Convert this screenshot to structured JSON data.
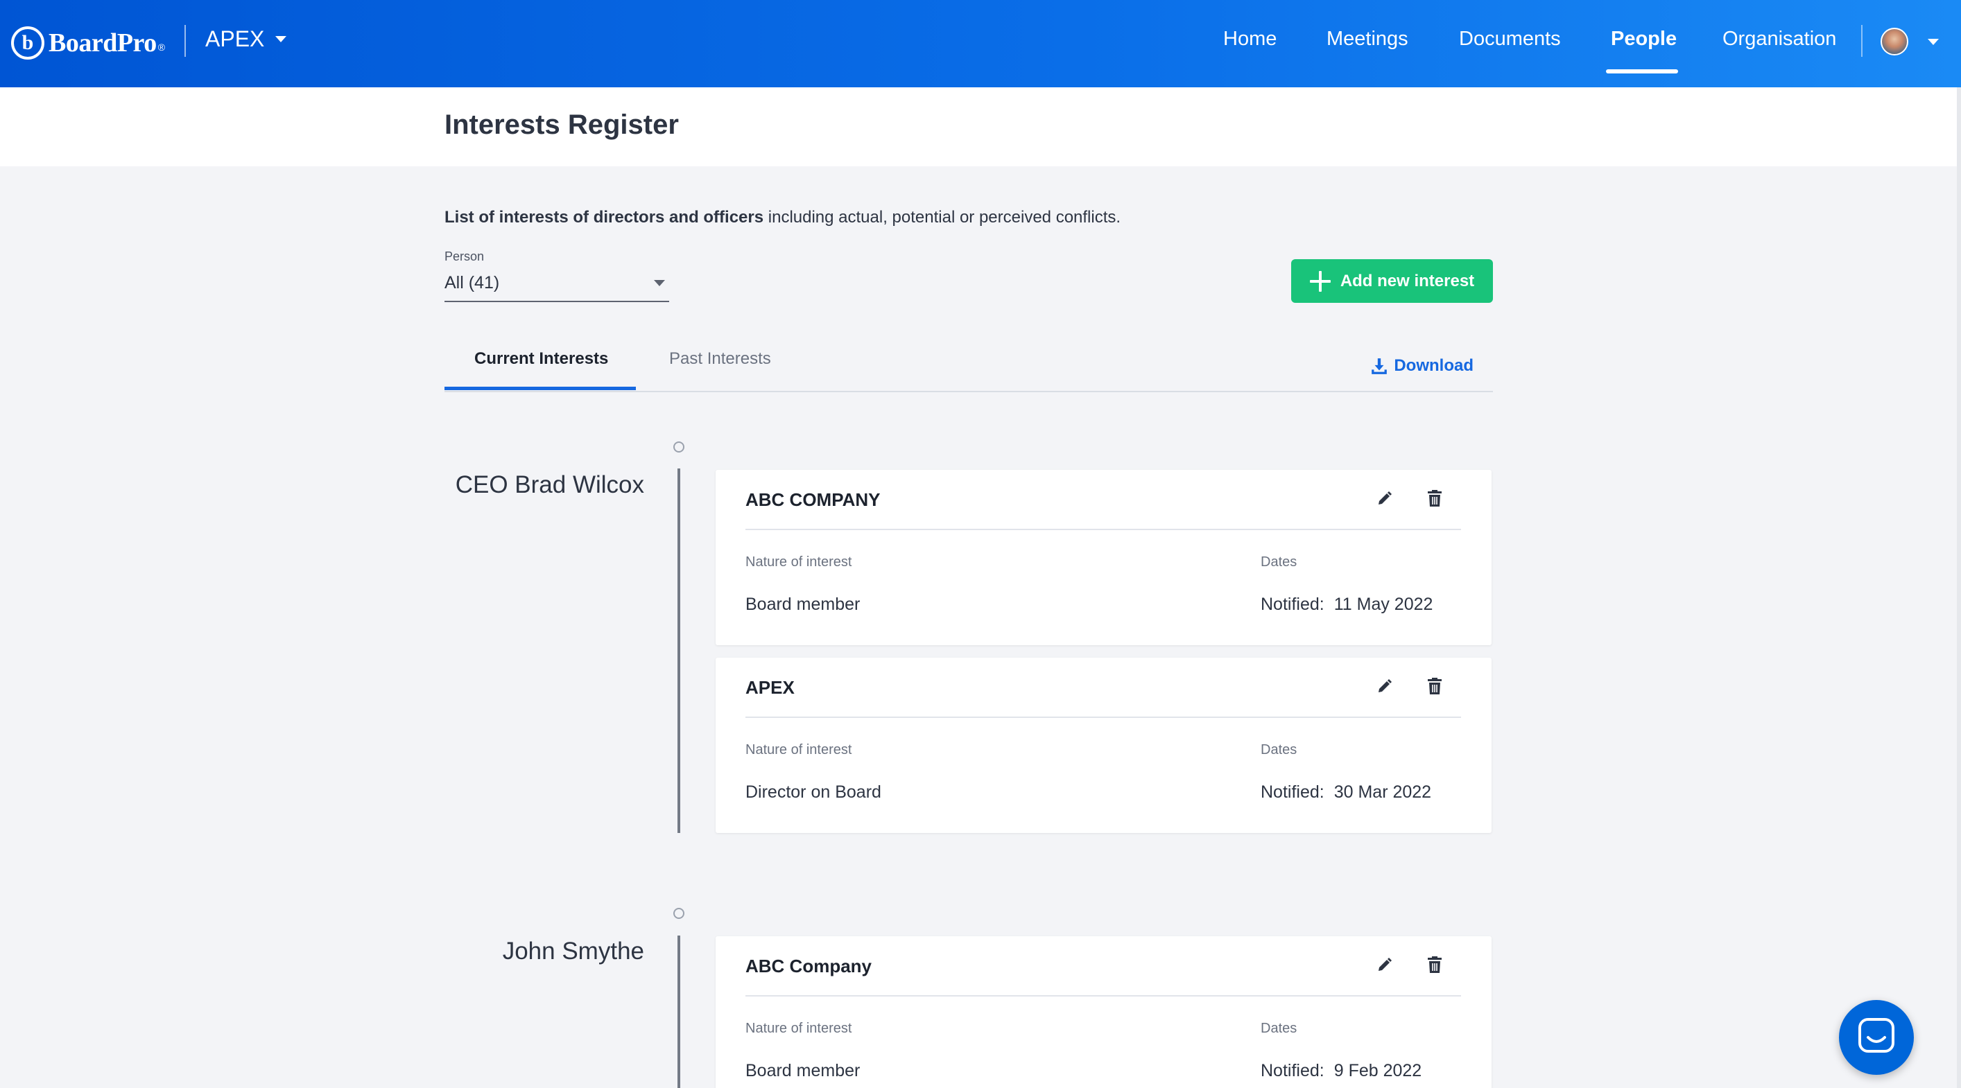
{
  "app": {
    "logo_mark": "b",
    "logo_text": "BoardPro",
    "logo_tm": "®",
    "org_name": "APEX"
  },
  "nav": {
    "items": [
      {
        "label": "Home"
      },
      {
        "label": "Meetings"
      },
      {
        "label": "Documents"
      },
      {
        "label": "People",
        "active": true
      },
      {
        "label": "Organisation"
      }
    ]
  },
  "page": {
    "title": "Interests Register",
    "subtitle_bold": "List of interests of directors and officers",
    "subtitle_rest": " including actual, potential or perceived conflicts."
  },
  "filter": {
    "person_label": "Person",
    "person_value": "All (41)"
  },
  "actions": {
    "add_label": "Add new interest",
    "download_label": "Download"
  },
  "tabs": {
    "current": "Current Interests",
    "past": "Past Interests"
  },
  "field_labels": {
    "nature": "Nature of interest",
    "dates": "Dates",
    "notified": "Notified:"
  },
  "people": [
    {
      "name": "CEO Brad Wilcox",
      "interests": [
        {
          "company": "ABC COMPANY",
          "nature": "Board member",
          "notified": "11 May 2022"
        },
        {
          "company": "APEX",
          "nature": "Director on Board",
          "notified": "30 Mar 2022"
        }
      ]
    },
    {
      "name": "John Smythe",
      "interests": [
        {
          "company": "ABC Company",
          "nature": "Board member",
          "notified": "9 Feb 2022"
        }
      ]
    }
  ],
  "colors": {
    "nav_start": "#0055d4",
    "nav_end": "#1a8af5",
    "accent_green": "#19c37a",
    "link_blue": "#1668e0",
    "chat_blue": "#0066d9"
  }
}
